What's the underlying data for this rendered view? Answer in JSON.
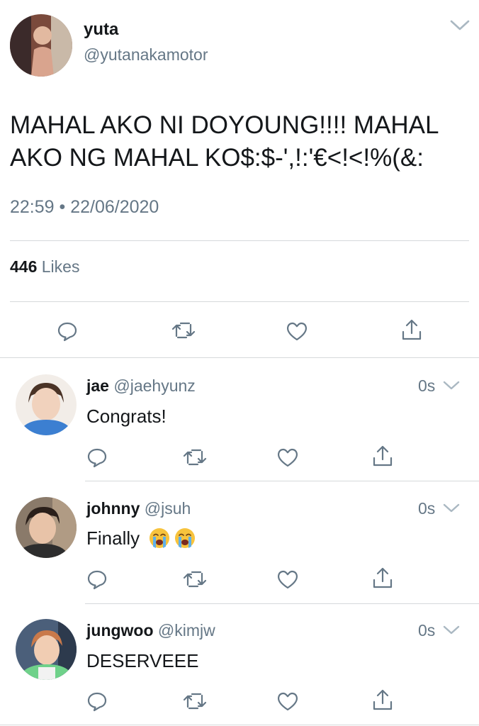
{
  "main_tweet": {
    "display_name": "yuta",
    "handle": "@yutanakamotor",
    "text_line1": "MAHAL AKO NI DOYOUNG!!!! MAHAL",
    "text_line2": "AKO NG MAHAL KO$:$-',!:'€<!<!%(&:",
    "timestamp": "22:59 • 22/06/2020",
    "likes_count": "446",
    "likes_label": "Likes"
  },
  "replies": [
    {
      "display_name": "jae",
      "handle": "@jaehyunz",
      "time": "0s",
      "text": "Congrats!"
    },
    {
      "display_name": "johnny",
      "handle": "@jsuh",
      "time": "0s",
      "text": "Finally",
      "emojis": [
        "loudly-crying-face",
        "loudly-crying-face"
      ]
    },
    {
      "display_name": "jungwoo",
      "handle": "@kimjw",
      "time": "0s",
      "text": "DESERVEEE"
    }
  ],
  "icons": {
    "reply": "speech-bubble-icon",
    "retweet": "retweet-icon",
    "like": "heart-icon",
    "share": "share-icon",
    "menu": "chevron-down-icon"
  },
  "colors": {
    "text": "#14171a",
    "secondary": "#657786",
    "divider": "#d6d9db",
    "icon": "#657786"
  }
}
